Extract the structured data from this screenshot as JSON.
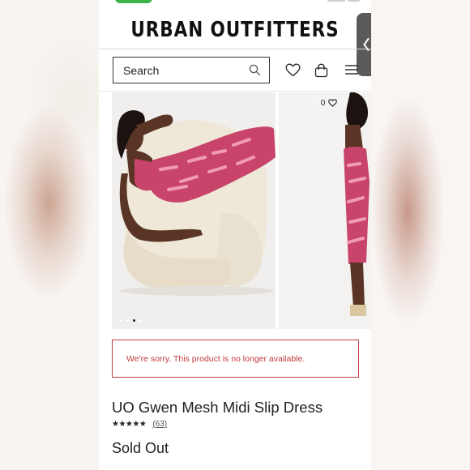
{
  "header": {
    "brand": "URBAN OUTFITTERS",
    "search_placeholder": "Search"
  },
  "icons": {
    "search": "search-icon",
    "wishlist": "heart-icon",
    "bag": "shopping-bag-icon",
    "menu": "hamburger-menu-icon",
    "side_tab": "chevron-left-icon"
  },
  "gallery": {
    "wishlist_count": "0",
    "dots_total": 3,
    "dots_active": 2
  },
  "alert": {
    "message": "We're sorry. This product is no longer available."
  },
  "product": {
    "title": "UO Gwen Mesh Midi Slip Dress",
    "stars": "★★★★★",
    "review_count": "(63)",
    "status": "Sold Out"
  },
  "colors": {
    "alert_red": "#c4383b",
    "text": "#222222",
    "dress_pink": "#c9446b",
    "status_green": "#3bb54a"
  }
}
